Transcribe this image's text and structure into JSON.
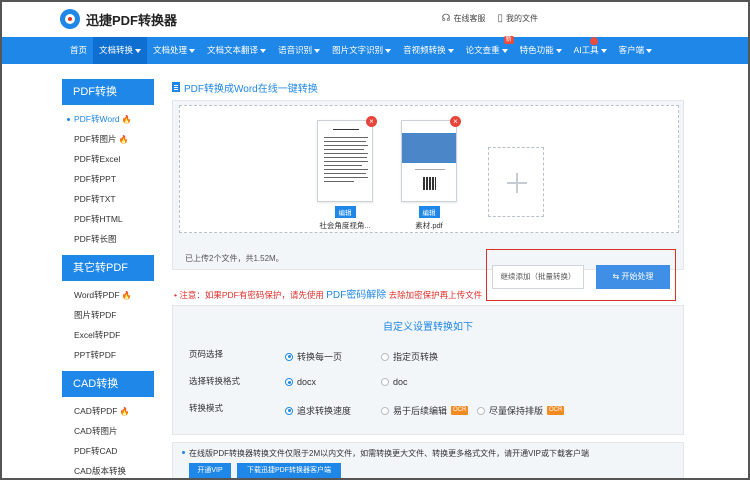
{
  "header": {
    "logo_text": "迅捷PDF转换器",
    "service_label": "在线客服",
    "myfiles_label": "我的文件"
  },
  "nav": {
    "items": [
      {
        "label": "首页"
      },
      {
        "label": "文档转换"
      },
      {
        "label": "文档处理"
      },
      {
        "label": "文档文本翻译"
      },
      {
        "label": "语音识别"
      },
      {
        "label": "图片文字识别"
      },
      {
        "label": "音视频转换"
      },
      {
        "label": "论文查重"
      },
      {
        "label": "特色功能"
      },
      {
        "label": "AI工具"
      },
      {
        "label": "客户端"
      }
    ],
    "new_badge": "新"
  },
  "sidebar": {
    "sections": [
      {
        "title": "PDF转换",
        "items": [
          "PDF转Word",
          "PDF转图片",
          "PDF转Excel",
          "PDF转PPT",
          "PDF转TXT",
          "PDF转HTML",
          "PDF转长图"
        ]
      },
      {
        "title": "其它转PDF",
        "items": [
          "Word转PDF",
          "图片转PDF",
          "Excel转PDF",
          "PPT转PDF"
        ]
      },
      {
        "title": "CAD转换",
        "items": [
          "CAD转PDF",
          "CAD转图片",
          "PDF转CAD",
          "CAD版本转换"
        ]
      }
    ]
  },
  "main": {
    "title": "PDF转换成Word在线一键转换",
    "files": [
      {
        "name": "社会角度视角...",
        "edit_label": "编辑"
      },
      {
        "name": "素材.pdf",
        "edit_label": "编辑"
      }
    ],
    "upload_status": "已上传2个文件，共1.52M。",
    "continue_label": "继续添加（批量转换）",
    "start_label": "开始处理",
    "notice_prefix": "注意：如果PDF有密码保护，请先使用",
    "notice_link": "PDF密码解除",
    "notice_suffix": "去除加密保护再上传文件",
    "settings_title": "自定义设置转换如下",
    "options": [
      {
        "label": "页码选择",
        "choices": [
          {
            "text": "转换每一页",
            "selected": true,
            "ocr": false
          },
          {
            "text": "指定页转换",
            "selected": false,
            "ocr": false
          }
        ]
      },
      {
        "label": "选择转换格式",
        "choices": [
          {
            "text": "docx",
            "selected": true,
            "ocr": false
          },
          {
            "text": "doc",
            "selected": false,
            "ocr": false
          }
        ]
      },
      {
        "label": "转换模式",
        "choices": [
          {
            "text": "追求转换速度",
            "selected": true,
            "ocr": false
          },
          {
            "text": "易于后续编辑",
            "selected": false,
            "ocr": true
          },
          {
            "text": "尽量保持排版",
            "selected": false,
            "ocr": true
          }
        ]
      }
    ],
    "ocr_label": "OCR",
    "footer_text": "在线版PDF转换器转换文件仅限于2M以内文件，如需转换更大文件、转换更多格式文件，请开通VIP或下载客户端",
    "vip_label": "开通VIP",
    "download_label": "下载迅捷PDF转换器客户端"
  },
  "colors": {
    "brand": "#1f87e8",
    "warning": "#e0312d",
    "ocr": "#f58b20"
  }
}
